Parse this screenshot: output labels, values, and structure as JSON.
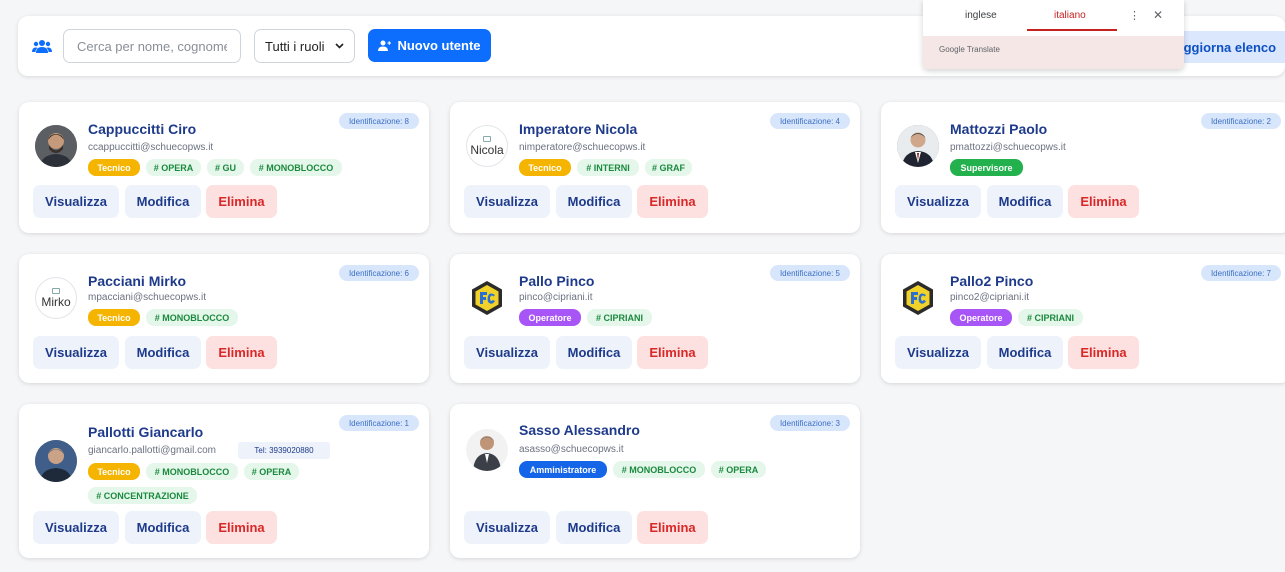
{
  "toolbar": {
    "search_placeholder": "Cerca per nome, cognome,",
    "role_filter": "Tutti i ruoli",
    "new_user_label": "Nuovo utente",
    "refresh_label": "iggiorna elenco"
  },
  "translate_popup": {
    "lang_source": "inglese",
    "lang_target": "italiano",
    "brand": "Google Translate"
  },
  "actions": {
    "view": "Visualizza",
    "edit": "Modifica",
    "delete": "Elimina"
  },
  "users": [
    {
      "name": "Cappuccitti Ciro",
      "email": "ccappuccitti@schuecopws.it",
      "id_label": "Identificazione: 8",
      "role": "Tecnico",
      "tags": [
        "# OPERA",
        "# GU",
        "# MONOBLOCCO"
      ],
      "avatar": "photo"
    },
    {
      "name": "Imperatore Nicola",
      "email": "nimperatore@schuecopws.it",
      "id_label": "Identificazione: 4",
      "role": "Tecnico",
      "tags": [
        "# INTERNI",
        "# GRAF"
      ],
      "avatar": "broken",
      "avatar_alt": "Nicola"
    },
    {
      "name": "Mattozzi Paolo",
      "email": "pmattozzi@schuecopws.it",
      "id_label": "Identificazione: 2",
      "role": "Supervisore",
      "tags": [],
      "avatar": "photo"
    },
    {
      "name": "Pacciani Mirko",
      "email": "mpacciani@schuecopws.it",
      "id_label": "Identificazione: 6",
      "role": "Tecnico",
      "tags": [
        "# MONOBLOCCO"
      ],
      "avatar": "broken",
      "avatar_alt": "Mirko"
    },
    {
      "name": "Pallo Pinco",
      "email": "pinco@cipriani.it",
      "id_label": "Identificazione: 5",
      "role": "Operatore",
      "tags": [
        "# CIPRIANI"
      ],
      "avatar": "logo"
    },
    {
      "name": "Pallo2 Pinco",
      "email": "pinco2@cipriani.it",
      "id_label": "Identificazione: 7",
      "role": "Operatore",
      "tags": [
        "# CIPRIANI"
      ],
      "avatar": "logo"
    },
    {
      "name": "Pallotti Giancarlo",
      "email": "giancarlo.pallotti@gmail.com",
      "phone": "Tel: 3939020880",
      "id_label": "Identificazione: 1",
      "role": "Tecnico",
      "tags": [
        "# MONOBLOCCO",
        "# OPERA",
        "# CONCENTRAZIONE"
      ],
      "avatar": "photo"
    },
    {
      "name": "Sasso Alessandro",
      "email": "asasso@schuecopws.it",
      "id_label": "Identificazione: 3",
      "role": "Amministratore",
      "tags": [
        "# MONOBLOCCO",
        "# OPERA"
      ],
      "avatar": "photo"
    }
  ],
  "colors": {
    "primary": "#0d6efd",
    "name": "#1e3a8a",
    "tecnico": "#f5b400",
    "supervisore": "#22b14c",
    "operatore": "#a855f7",
    "amministratore": "#1565e8",
    "tag_bg": "#e5f6ea",
    "tag_fg": "#1a8a3e",
    "delete_bg": "#fde0e0",
    "delete_fg": "#d82828"
  }
}
